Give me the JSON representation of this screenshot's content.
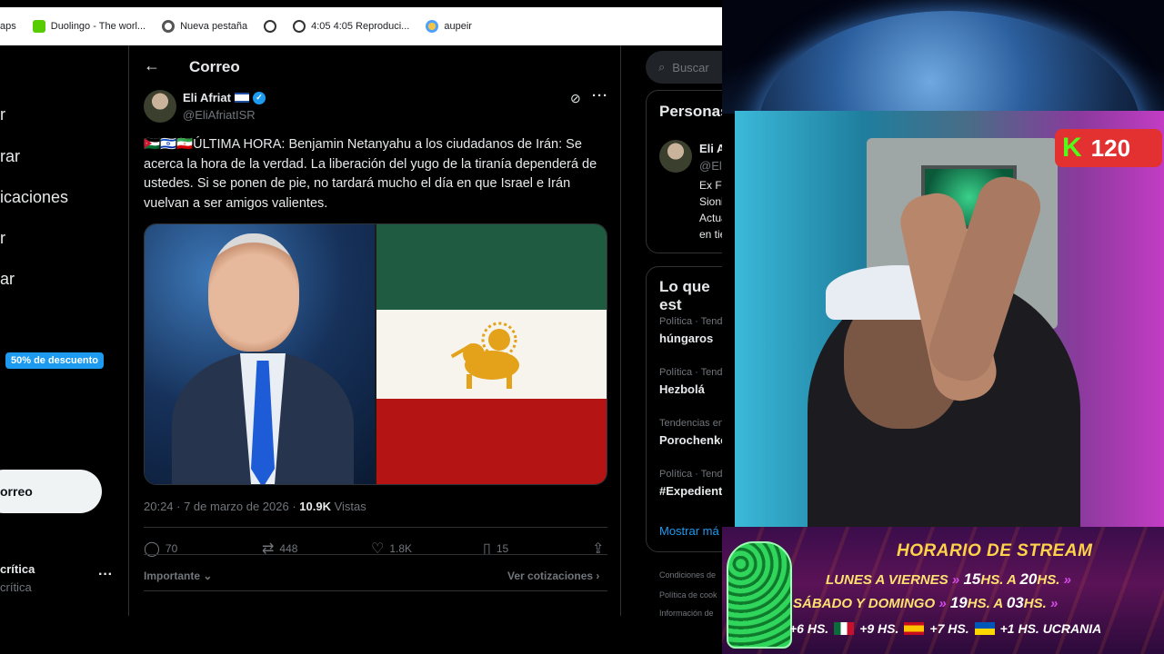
{
  "browser": {
    "bookmarks": [
      {
        "label": "aps",
        "icon": "apps-icon"
      },
      {
        "label": "Duolingo - The worl...",
        "icon": "duolingo-icon"
      },
      {
        "label": "Nueva pestaña",
        "icon": "chrome-icon"
      },
      {
        "label": "",
        "icon": "globe-icon"
      },
      {
        "label": "4:05 4:05 Reproduci...",
        "icon": "globe-icon"
      },
      {
        "label": "aupeir",
        "icon": "aupeir-icon"
      }
    ]
  },
  "left_nav": {
    "items": [
      "r",
      "rar",
      "icaciones",
      "r",
      "ar"
    ],
    "promo_badge": "50% de descuento",
    "post_button": "orreo",
    "account_name": "crítica",
    "account_handle": "crítica",
    "more": "···"
  },
  "header": {
    "title": "Correo",
    "back_icon": "arrow-left-icon"
  },
  "tweet": {
    "author": "Eli Afriat",
    "handle": "@EliAfriatISR",
    "text": "ÚLTIMA HORA: Benjamin Netanyahu a los ciudadanos de Irán: Se acerca la hora de la verdad. La liberación del yugo de la tiranía dependerá de ustedes. Si se ponen de pie, no tardará mucho el día en que Israel e Irán vuelvan a ser amigos valientes.",
    "emoji_prefix": "🇯🇴🇮🇱🇮🇷",
    "time": "20:24 · 7 de marzo de 2026 · ",
    "views_count": "10.9K",
    "views_label": " Vistas",
    "replies": "70",
    "retweets": "448",
    "likes": "1.8K",
    "bookmarks": "15",
    "sort_label": "Importante",
    "quotes_label": "Ver cotizaciones"
  },
  "sidebar_right": {
    "search_placeholder": "Buscar",
    "people_title": "Personas",
    "person_name": "Eli Afri",
    "person_handle": "@EliAf",
    "bio_lines": [
      "Ex FDI",
      "Sionist",
      "Actual",
      "en tien"
    ],
    "trends_title": "Lo que est",
    "trends": [
      {
        "context": "Política · Tender",
        "name": "húngaros"
      },
      {
        "context": "Política · Tender",
        "name": "Hezbolá"
      },
      {
        "context": "Tendencias en U",
        "name": "Porochenko"
      },
      {
        "context": "Política · Tender",
        "name": "#Expediente"
      }
    ],
    "show_more": "Mostrar má",
    "footer": [
      "Condiciones de",
      "Política de cook",
      "Información de"
    ]
  },
  "stream": {
    "kick_viewers": "120",
    "kick_logo": "K",
    "schedule_title": "HORARIO DE STREAM",
    "row1_days": "LUNES A VIERNES",
    "row1_from": "15",
    "row1_to": "20",
    "row2_days": "SÁBADO Y DOMINGO",
    "row2_from": "19",
    "row2_to": "03",
    "hs_label": "HS.",
    "a_label": "A",
    "zones": [
      "+6 HS.",
      "+9 HS.",
      "+7 HS.",
      "+1 HS. UCRANIA"
    ]
  },
  "colors": {
    "accent": "#1d9bf0",
    "background": "#000000",
    "kick": "#53fc18"
  }
}
